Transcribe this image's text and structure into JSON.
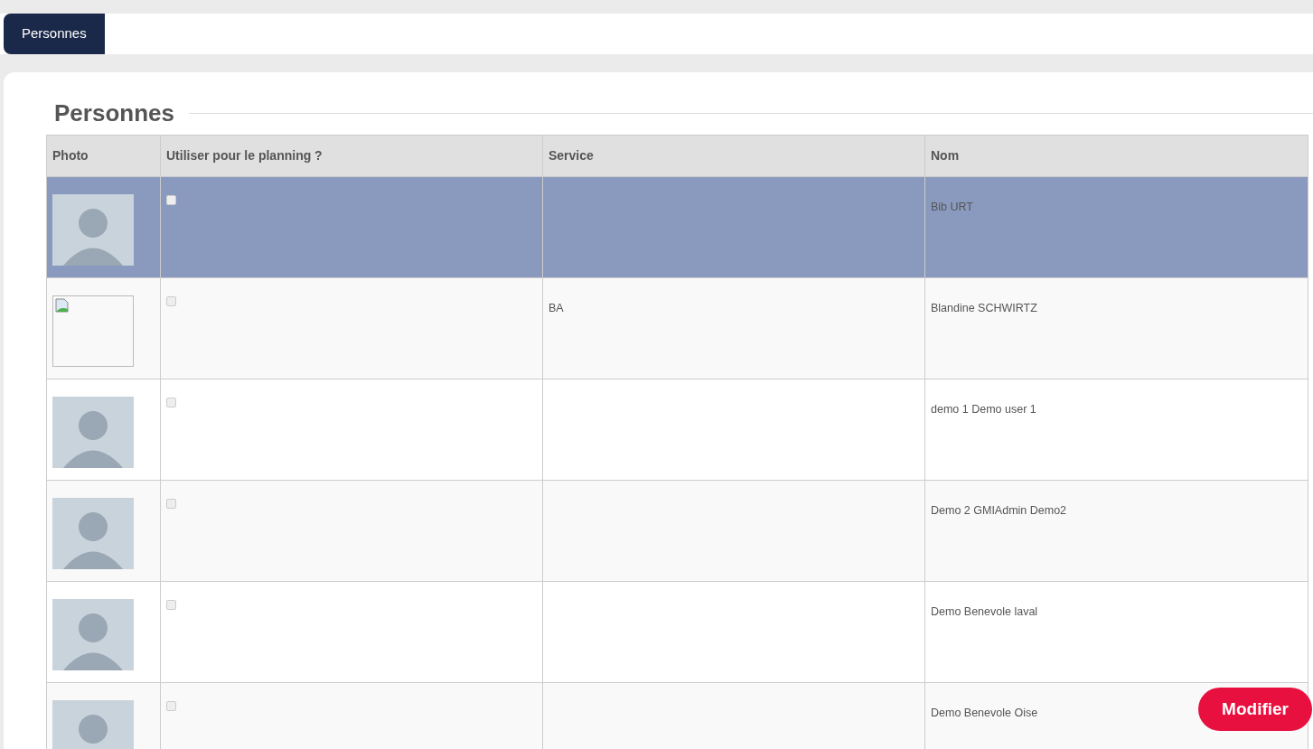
{
  "tabs": [
    {
      "label": "Personnes",
      "selected": true
    }
  ],
  "section_title": "Personnes",
  "table": {
    "columns": [
      "Photo",
      "Utiliser pour le planning ?",
      "Service",
      "Nom"
    ],
    "rows": [
      {
        "kind": "avatar",
        "use_for_planning": false,
        "service": "",
        "name": "Bib URT",
        "selected": true
      },
      {
        "kind": "broken",
        "use_for_planning": false,
        "service": "BA",
        "name": "Blandine SCHWIRTZ",
        "selected": false
      },
      {
        "kind": "avatar",
        "use_for_planning": false,
        "service": "",
        "name": "demo 1 Demo user 1",
        "selected": false
      },
      {
        "kind": "avatar",
        "use_for_planning": false,
        "service": "",
        "name": "Demo 2 GMIAdmin Demo2",
        "selected": false
      },
      {
        "kind": "avatar",
        "use_for_planning": false,
        "service": "",
        "name": "Demo Benevole laval",
        "selected": false
      },
      {
        "kind": "avatar",
        "use_for_planning": false,
        "service": "",
        "name": "Demo Benevole Oise",
        "selected": false
      }
    ]
  },
  "action_button": "Modifier"
}
